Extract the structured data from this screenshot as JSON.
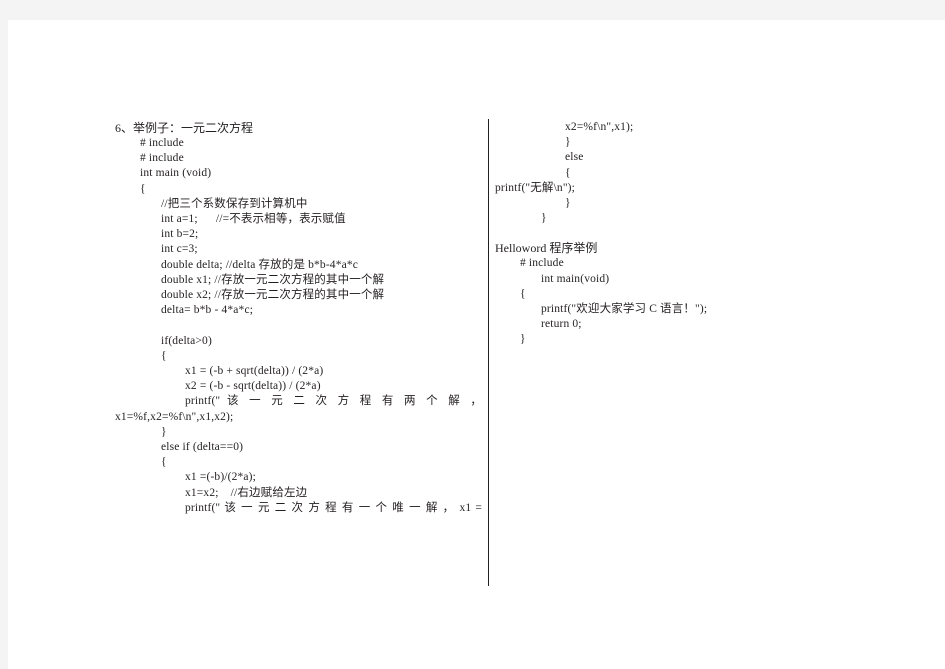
{
  "document": {
    "page_background": "#ffffff",
    "canvas_background": "#f4f4f5",
    "text_color": "#231f20",
    "divider_color": "#231f20"
  },
  "left_column": {
    "heading": "6、举例子：一元二次方程",
    "lines": [
      {
        "indent": 1,
        "text": "# include"
      },
      {
        "indent": 1,
        "text": "# include"
      },
      {
        "indent": 1,
        "text": "int main (void)"
      },
      {
        "indent": 1,
        "text": "{"
      },
      {
        "indent": 2,
        "text": "//把三个系数保存到计算机中"
      },
      {
        "indent": 2,
        "text": "int a=1;      //=不表示相等，表示赋值"
      },
      {
        "indent": 2,
        "text": "int b=2;"
      },
      {
        "indent": 2,
        "text": "int c=3;"
      },
      {
        "indent": 2,
        "text": "double delta; //delta 存放的是 b*b-4*a*c"
      },
      {
        "indent": 2,
        "text": "double x1; //存放一元二次方程的其中一个解"
      },
      {
        "indent": 2,
        "text": "double x2; //存放一元二次方程的其中一个解"
      },
      {
        "indent": 2,
        "text": "delta= b*b - 4*a*c;"
      },
      {
        "indent": 2,
        "text": ""
      },
      {
        "indent": 2,
        "text": "if(delta>0)"
      },
      {
        "indent": 2,
        "text": "{"
      },
      {
        "indent": 3,
        "text": "x1 = (-b + sqrt(delta)) / (2*a)"
      },
      {
        "indent": 3,
        "text": "x2 = (-b - sqrt(delta)) / (2*a)"
      },
      {
        "indent": 3,
        "justified": true,
        "text": "printf(\" 该 一 元 二 次 方 程 有 两 个 解 ，"
      },
      {
        "indent": 0,
        "wrap": true,
        "text": "x1=%f,x2=%f\\n\",x1,x2);"
      },
      {
        "indent": 2,
        "text": "}"
      },
      {
        "indent": 2,
        "text": "else if (delta==0)"
      },
      {
        "indent": 2,
        "text": "{"
      },
      {
        "indent": 3,
        "text": "x1 =(-b)/(2*a);"
      },
      {
        "indent": 3,
        "text": "x1=x2;    //右边赋给左边"
      },
      {
        "indent": 3,
        "justified": true,
        "text": "printf(\" 该 一 元 二 次 方 程 有 一 个 唯 一 解 ， x1  ="
      }
    ]
  },
  "right_column": {
    "lines_top": [
      {
        "indent": 3,
        "text": "x2=%f\\n\",x1);"
      },
      {
        "indent": 3,
        "text": "}"
      },
      {
        "indent": 3,
        "text": "else"
      },
      {
        "indent": 3,
        "text": "{"
      },
      {
        "indent": 4,
        "text": "printf(\"无解\\n\");"
      },
      {
        "indent": 3,
        "text": "}"
      },
      {
        "indent": 2,
        "text": "}"
      }
    ],
    "heading": "Helloword 程序举例",
    "lines_bottom": [
      {
        "indent": 1,
        "text": "# include"
      },
      {
        "indent": 2,
        "text": "int main(void)"
      },
      {
        "indent": 1,
        "text": "{"
      },
      {
        "indent": 2,
        "text": "printf(\"欢迎大家学习 C 语言！\");"
      },
      {
        "indent": 2,
        "text": "return 0;"
      },
      {
        "indent": 1,
        "text": "}"
      }
    ]
  }
}
